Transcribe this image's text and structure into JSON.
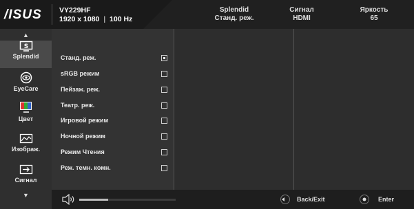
{
  "header": {
    "logo": "/ISUS",
    "model": "VY229HF",
    "resolution": "1920 x 1080",
    "refresh": "100 Hz",
    "cols": [
      {
        "title": "Splendid",
        "value": "Станд. реж."
      },
      {
        "title": "Сигнал",
        "value": "HDMI"
      },
      {
        "title": "Яркость",
        "value": "65"
      }
    ]
  },
  "sidebar": {
    "items": [
      {
        "label": "Splendid",
        "icon": "splendid-icon"
      },
      {
        "label": "EyeCare",
        "icon": "eye-icon"
      },
      {
        "label": "Цвет",
        "icon": "color-icon"
      },
      {
        "label": "Изображ.",
        "icon": "image-icon"
      },
      {
        "label": "Сигнал",
        "icon": "input-signal-icon"
      }
    ]
  },
  "menu": {
    "items": [
      {
        "label": "Станд. реж.",
        "checked": true
      },
      {
        "label": "sRGB режим",
        "checked": false
      },
      {
        "label": "Пейзаж. реж.",
        "checked": false
      },
      {
        "label": "Театр. реж.",
        "checked": false
      },
      {
        "label": "Игровой режим",
        "checked": false
      },
      {
        "label": "Ночной режим",
        "checked": false
      },
      {
        "label": "Режим Чтения",
        "checked": false
      },
      {
        "label": "Реж. темн. комн.",
        "checked": false
      }
    ]
  },
  "bottom": {
    "volume_level": 0.3,
    "back_label": "Back/Exit",
    "enter_label": "Enter"
  },
  "colors": {
    "background": "#262626",
    "active": "#4a4a4a"
  }
}
